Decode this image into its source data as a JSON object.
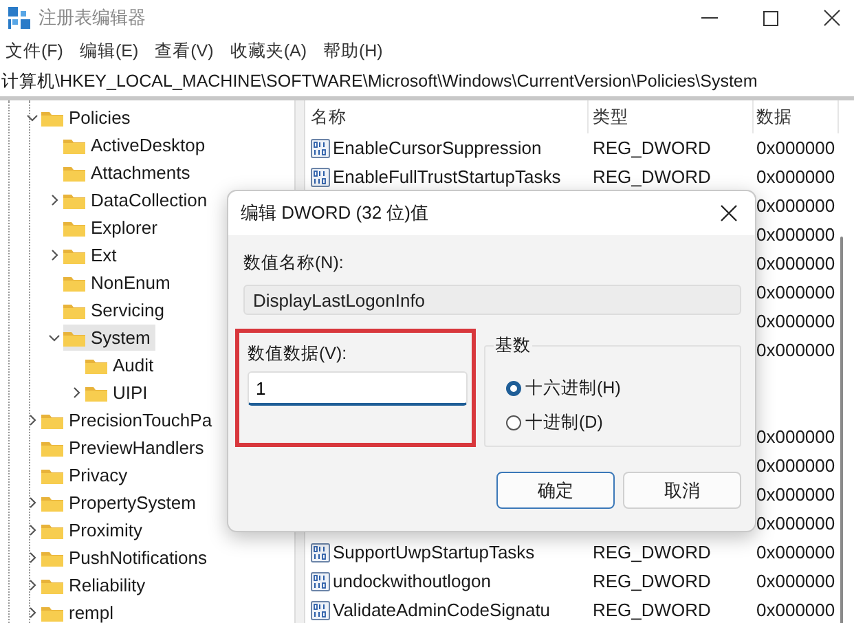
{
  "window": {
    "title": "注册表编辑器"
  },
  "menu": [
    "文件(F)",
    "编辑(E)",
    "查看(V)",
    "收藏夹(A)",
    "帮助(H)"
  ],
  "address": "计算机\\HKEY_LOCAL_MACHINE\\SOFTWARE\\Microsoft\\Windows\\CurrentVersion\\Policies\\System",
  "tree": [
    {
      "name": "Policies",
      "kind": "branch",
      "expanded": true,
      "selected": false,
      "children": [
        {
          "name": "ActiveDesktop",
          "kind": "leaf",
          "selected": false
        },
        {
          "name": "Attachments",
          "kind": "leaf",
          "selected": false
        },
        {
          "name": "DataCollection",
          "kind": "branch",
          "expanded": false,
          "selected": false
        },
        {
          "name": "Explorer",
          "kind": "leaf",
          "selected": false
        },
        {
          "name": "Ext",
          "kind": "branch",
          "expanded": false,
          "selected": false
        },
        {
          "name": "NonEnum",
          "kind": "leaf",
          "selected": false
        },
        {
          "name": "Servicing",
          "kind": "leaf",
          "selected": false
        },
        {
          "name": "System",
          "kind": "branch",
          "expanded": true,
          "selected": true,
          "children": [
            {
              "name": "Audit",
              "kind": "leaf",
              "selected": false
            },
            {
              "name": "UIPI",
              "kind": "branch",
              "expanded": false,
              "selected": false
            }
          ]
        }
      ]
    },
    {
      "name": "PrecisionTouchPa",
      "kind": "branch",
      "expanded": false,
      "selected": false
    },
    {
      "name": "PreviewHandlers",
      "kind": "leaf",
      "selected": false
    },
    {
      "name": "Privacy",
      "kind": "leaf",
      "selected": false
    },
    {
      "name": "PropertySystem",
      "kind": "branch",
      "expanded": false,
      "selected": false
    },
    {
      "name": "Proximity",
      "kind": "branch",
      "expanded": false,
      "selected": false
    },
    {
      "name": "PushNotifications",
      "kind": "branch",
      "expanded": false,
      "selected": false
    },
    {
      "name": "Reliability",
      "kind": "branch",
      "expanded": false,
      "selected": false
    },
    {
      "name": "rempl",
      "kind": "branch",
      "expanded": false,
      "selected": false
    }
  ],
  "table": {
    "columns": [
      "名称",
      "类型",
      "数据"
    ],
    "rows": [
      {
        "name": "EnableCursorSuppression",
        "type": "REG_DWORD",
        "data": "0x000000"
      },
      {
        "name": "EnableFullTrustStartupTasks",
        "type": "REG_DWORD",
        "data": "0x000000"
      },
      {
        "data": "0x000000"
      },
      {
        "data": "0x000000"
      },
      {
        "data": "0x000000"
      },
      {
        "data": "0x000000"
      },
      {
        "data": "0x000000"
      },
      {
        "data": "0x000000"
      },
      {},
      {},
      {
        "data": "0x000000"
      },
      {
        "data": "0x000000"
      },
      {
        "data": "0x000000"
      },
      {
        "data": "0x000000"
      },
      {
        "name": "SupportUwpStartupTasks",
        "type": "REG_DWORD",
        "data": "0x000000"
      },
      {
        "name": "undockwithoutlogon",
        "type": "REG_DWORD",
        "data": "0x000000"
      },
      {
        "name": "ValidateAdminCodeSignatu",
        "type": "REG_DWORD",
        "data": "0x000000"
      }
    ]
  },
  "dialog": {
    "title": "编辑 DWORD (32 位)值",
    "name_label": "数值名称(N):",
    "name_value": "DisplayLastLogonInfo",
    "data_label": "数值数据(V):",
    "data_value": "1",
    "data_highlighted": true,
    "base_label": "基数",
    "bases": [
      {
        "label": "十六进制(H)",
        "selected": true
      },
      {
        "label": "十进制(D)",
        "selected": false
      }
    ],
    "buttons": [
      {
        "label": "确定",
        "default": true
      },
      {
        "label": "取消",
        "default": false
      }
    ]
  }
}
